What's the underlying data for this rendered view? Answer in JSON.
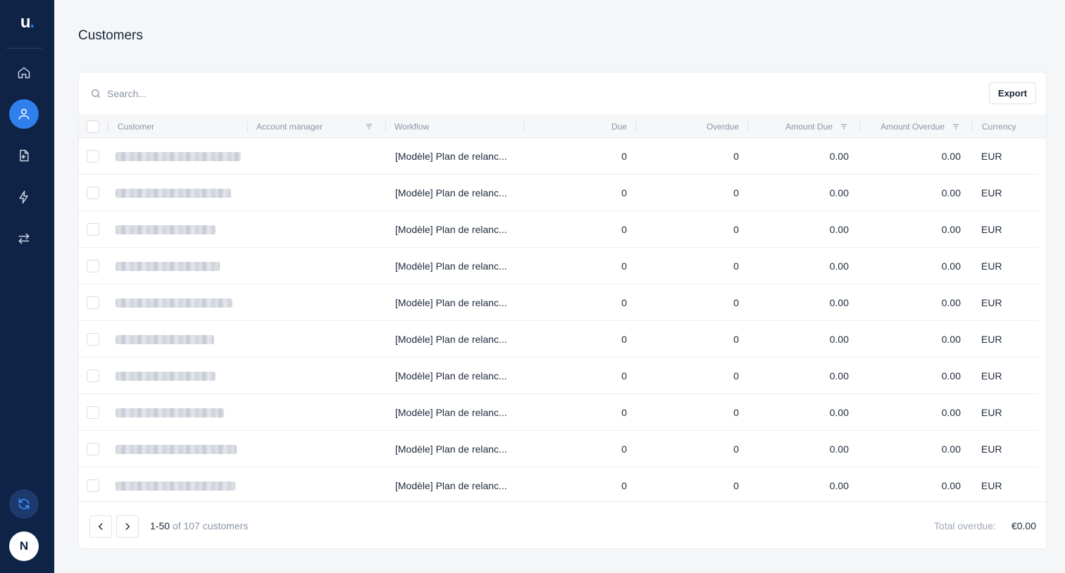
{
  "app": {
    "logo_text": "u",
    "logo_dot": "."
  },
  "sidebar": {
    "items": [
      {
        "name": "home",
        "icon": "home-icon",
        "active": false
      },
      {
        "name": "customers",
        "icon": "user-icon",
        "active": true
      },
      {
        "name": "documents",
        "icon": "file-import-icon",
        "active": false
      },
      {
        "name": "automations",
        "icon": "lightning-icon",
        "active": false
      },
      {
        "name": "transfers",
        "icon": "arrows-left-right-icon",
        "active": false
      }
    ],
    "sync_icon": "sync-icon",
    "avatar_initial": "N"
  },
  "page": {
    "title": "Customers"
  },
  "search": {
    "placeholder": "Search...",
    "value": ""
  },
  "toolbar": {
    "export_label": "Export"
  },
  "table": {
    "columns": {
      "customer": "Customer",
      "account_manager": "Account manager",
      "workflow": "Workflow",
      "due": "Due",
      "overdue": "Overdue",
      "amount_due": "Amount Due",
      "amount_overdue": "Amount Overdue",
      "currency": "Currency"
    },
    "rows": [
      {
        "workflow": "[Modèle] Plan de relanc...",
        "due": "0",
        "overdue": "0",
        "amount_due": "0.00",
        "amount_overdue": "0.00",
        "currency": "EUR"
      },
      {
        "workflow": "[Modèle] Plan de relanc...",
        "due": "0",
        "overdue": "0",
        "amount_due": "0.00",
        "amount_overdue": "0.00",
        "currency": "EUR"
      },
      {
        "workflow": "[Modèle] Plan de relanc...",
        "due": "0",
        "overdue": "0",
        "amount_due": "0.00",
        "amount_overdue": "0.00",
        "currency": "EUR"
      },
      {
        "workflow": "[Modèle] Plan de relanc...",
        "due": "0",
        "overdue": "0",
        "amount_due": "0.00",
        "amount_overdue": "0.00",
        "currency": "EUR"
      },
      {
        "workflow": "[Modèle] Plan de relanc...",
        "due": "0",
        "overdue": "0",
        "amount_due": "0.00",
        "amount_overdue": "0.00",
        "currency": "EUR"
      },
      {
        "workflow": "[Modèle] Plan de relanc...",
        "due": "0",
        "overdue": "0",
        "amount_due": "0.00",
        "amount_overdue": "0.00",
        "currency": "EUR"
      },
      {
        "workflow": "[Modèle] Plan de relanc...",
        "due": "0",
        "overdue": "0",
        "amount_due": "0.00",
        "amount_overdue": "0.00",
        "currency": "EUR"
      },
      {
        "workflow": "[Modèle] Plan de relanc...",
        "due": "0",
        "overdue": "0",
        "amount_due": "0.00",
        "amount_overdue": "0.00",
        "currency": "EUR"
      },
      {
        "workflow": "[Modèle] Plan de relanc...",
        "due": "0",
        "overdue": "0",
        "amount_due": "0.00",
        "amount_overdue": "0.00",
        "currency": "EUR"
      },
      {
        "workflow": "[Modèle] Plan de relanc...",
        "due": "0",
        "overdue": "0",
        "amount_due": "0.00",
        "amount_overdue": "0.00",
        "currency": "EUR"
      }
    ]
  },
  "pagination": {
    "range": "1-50",
    "of_text": "of 107 customers"
  },
  "totals": {
    "label": "Total overdue:",
    "value": "€0.00"
  }
}
